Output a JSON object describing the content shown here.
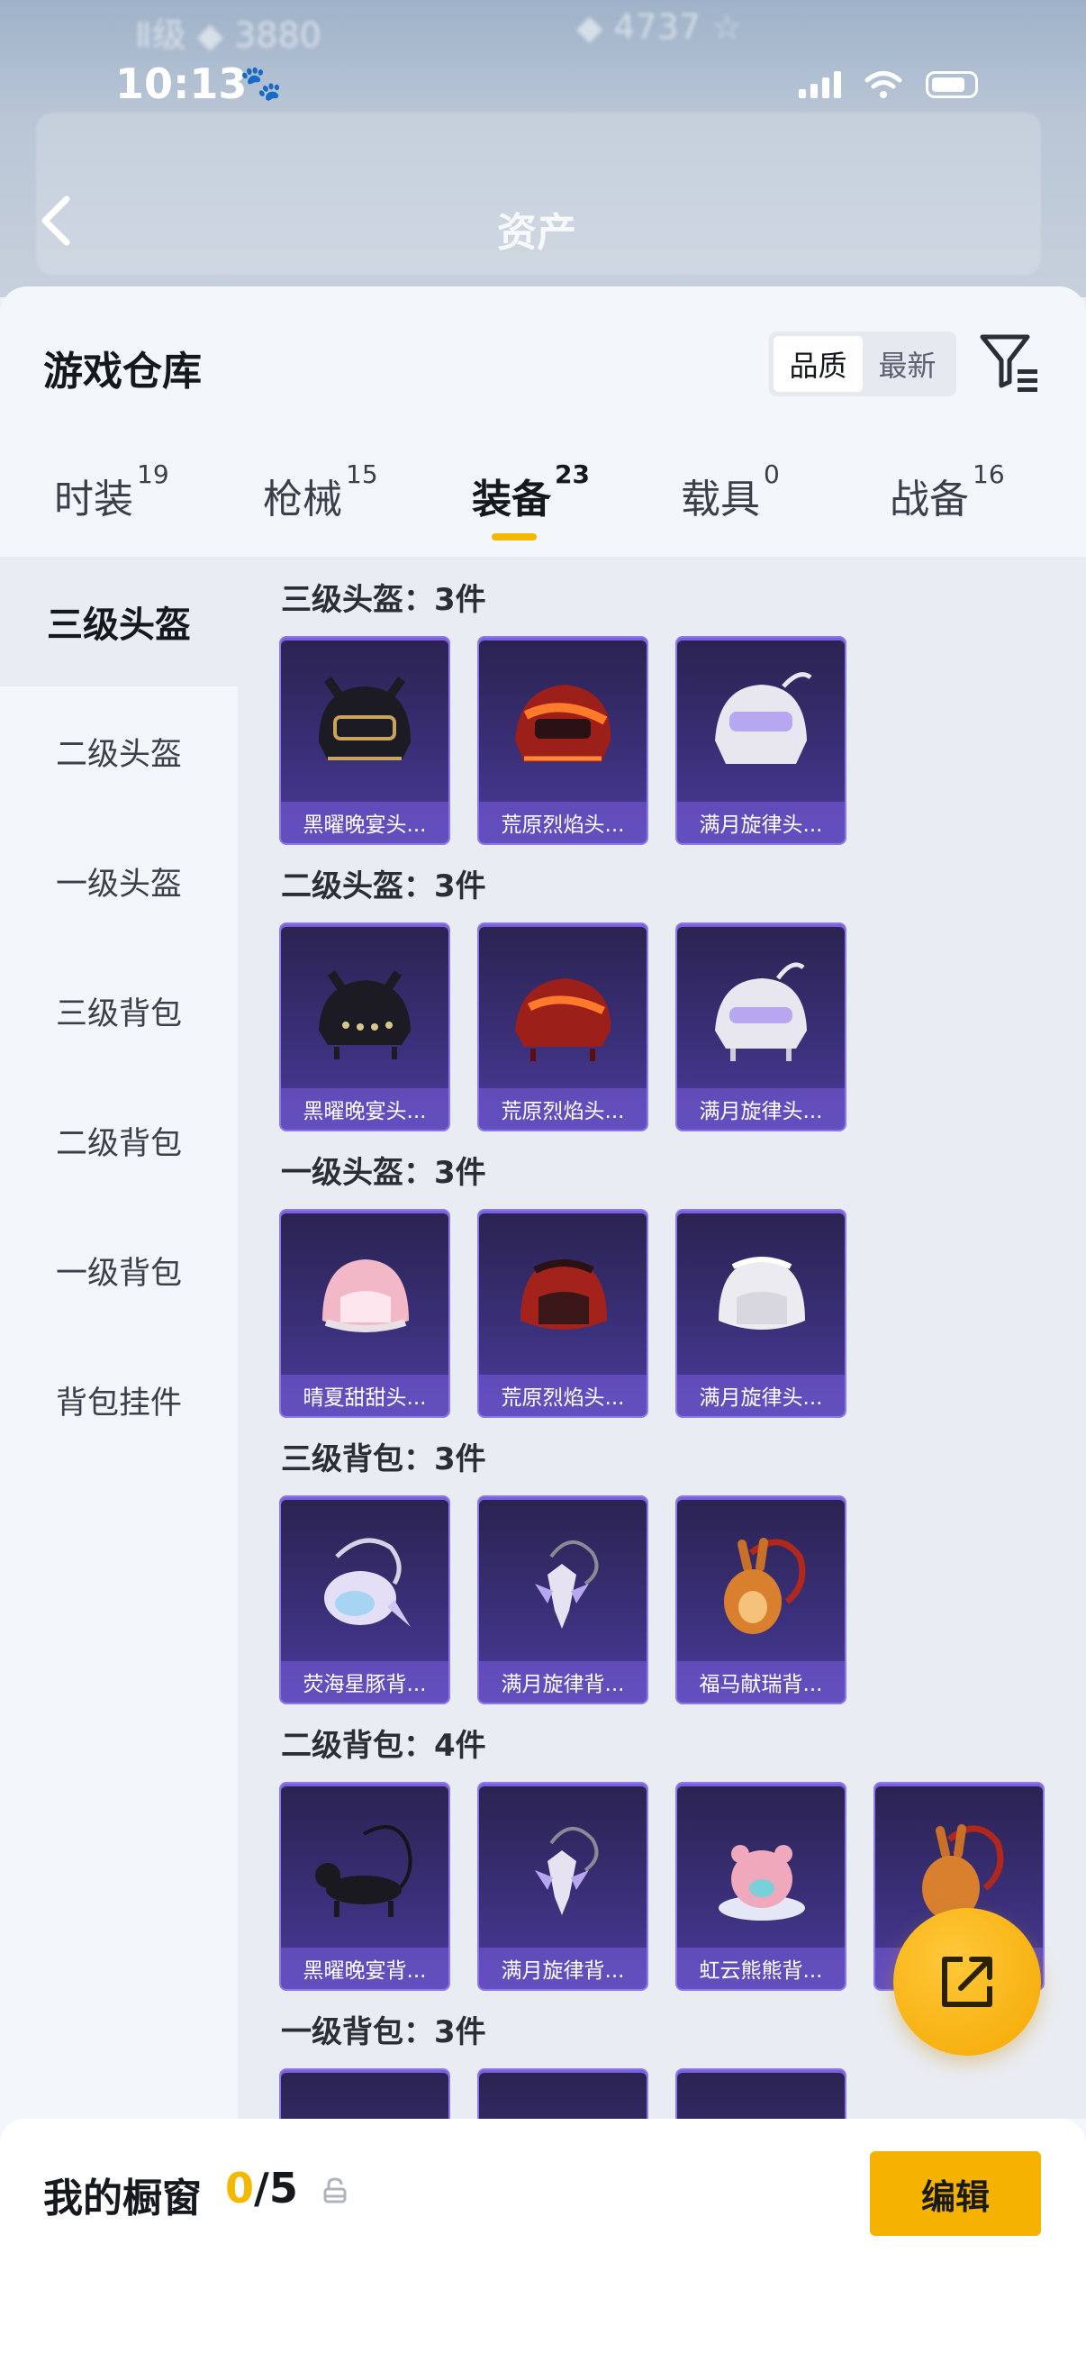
{
  "status_bar": {
    "time": "10:13"
  },
  "header": {
    "title": "资产"
  },
  "sheet": {
    "title": "游戏仓库",
    "sort_options": [
      "品质",
      "最新"
    ],
    "active_sort": "品质"
  },
  "tabs": [
    {
      "label": "时装",
      "count": "19"
    },
    {
      "label": "枪械",
      "count": "15"
    },
    {
      "label": "装备",
      "count": "23"
    },
    {
      "label": "载具",
      "count": "0"
    },
    {
      "label": "战备",
      "count": "16"
    }
  ],
  "active_tab": "装备",
  "sidebar": {
    "items": [
      "三级头盔",
      "二级头盔",
      "一级头盔",
      "三级背包",
      "二级背包",
      "一级背包",
      "背包挂件"
    ],
    "active": "三级头盔"
  },
  "sections": [
    {
      "title": "三级头盔：3件",
      "items": [
        "黑曜晚宴头...",
        "荒原烈焰头...",
        "满月旋律头..."
      ]
    },
    {
      "title": "二级头盔：3件",
      "items": [
        "黑曜晚宴头...",
        "荒原烈焰头...",
        "满月旋律头..."
      ]
    },
    {
      "title": "一级头盔：3件",
      "items": [
        "晴夏甜甜头...",
        "荒原烈焰头...",
        "满月旋律头..."
      ]
    },
    {
      "title": "三级背包：3件",
      "items": [
        "荧海星豚背...",
        "满月旋律背...",
        "福马献瑞背..."
      ]
    },
    {
      "title": "二级背包：4件",
      "items": [
        "黑曜晚宴背...",
        "满月旋律背...",
        "虹云熊熊背...",
        ""
      ]
    },
    {
      "title": "一级背包：3件",
      "items": [
        "",
        "",
        ""
      ]
    }
  ],
  "showcase": {
    "label": "我的橱窗",
    "current": "0",
    "total": "/5",
    "edit_label": "编辑"
  },
  "colors": {
    "accent": "#f5b800",
    "card_bg": "#3a2f78"
  }
}
